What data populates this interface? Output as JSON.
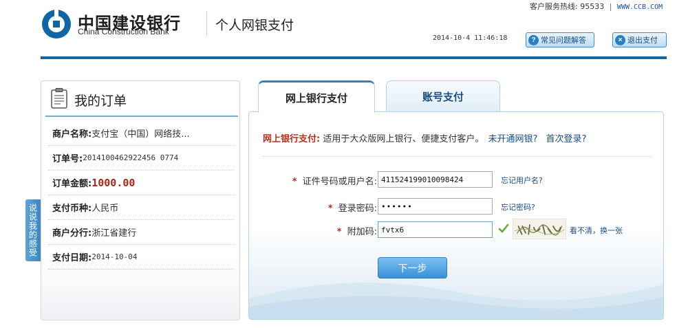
{
  "header": {
    "bank_name_cn": "中国建设银行",
    "bank_name_en": "China Construction Bank",
    "service_title": "个人网银支付",
    "hotline_label": "客户服务热线: 95533",
    "separator": "|",
    "website": "WWW.CCB.COM",
    "datetime": "2014-10-4 11:46:18",
    "faq_label": "常见问题解答",
    "exit_label": "退出支付",
    "faq_icon_glyph": "?",
    "exit_icon_glyph": "×"
  },
  "colors": {
    "brand_blue": "#0e66a6",
    "accent_red": "#b5301f",
    "link_blue": "#1b4c82",
    "amount_red": "#a5281b"
  },
  "order": {
    "title": "我的订单",
    "rows": [
      {
        "label": "商户名称:",
        "value": "支付宝（中国）网络技..."
      },
      {
        "label": "订单号:",
        "value": "2014100462922456 0774"
      },
      {
        "label": "订单金额:",
        "value": "1000.00"
      },
      {
        "label": "支付币种:",
        "value": "人民币"
      },
      {
        "label": "商户分行:",
        "value": "浙江省建行"
      },
      {
        "label": "支付日期:",
        "value": "2014-10-04"
      }
    ]
  },
  "feedback_tab": "说说我的感受",
  "tabs": [
    {
      "label": "网上银行支付",
      "active": true
    },
    {
      "label": "账号支付",
      "active": false
    }
  ],
  "form": {
    "intro_title": "网上银行支付:",
    "intro_text": "适用于大众版网上银行、便捷支付客户。",
    "link_no_ebank": "未开通网银?",
    "link_first_login": "首次登录?",
    "fields": {
      "username": {
        "label": "证件号码或用户名:",
        "value": "411524199010098424",
        "help": "忘记用户名?"
      },
      "password": {
        "label": "登录密码:",
        "value": "••••••",
        "help": "忘记密码?"
      },
      "captcha": {
        "label": "附加码:",
        "value": "fvtx6",
        "help": "看不清，换一张"
      }
    },
    "required_mark": "*",
    "submit_label": "下一步"
  }
}
